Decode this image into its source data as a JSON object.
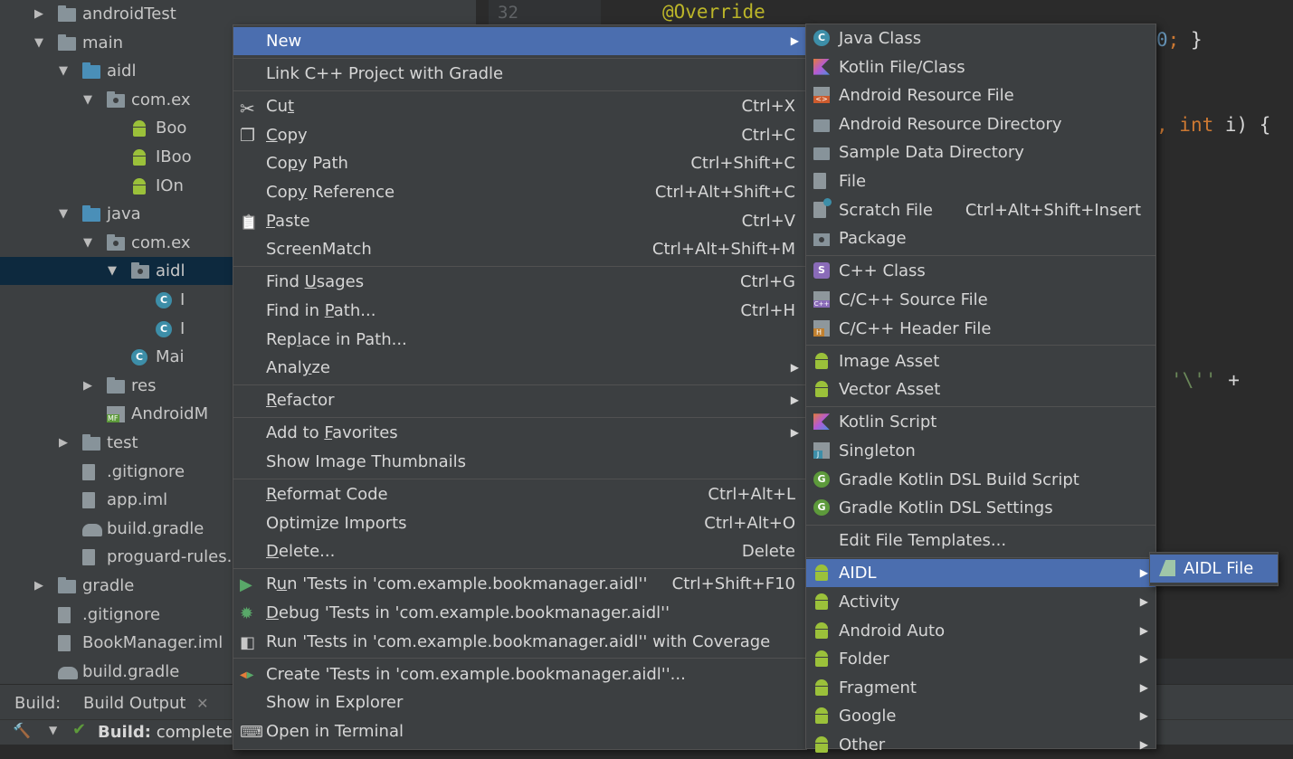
{
  "tree": [
    {
      "label": "androidTest",
      "indent": 1,
      "arrow": "▶",
      "icon": "folder"
    },
    {
      "label": "main",
      "indent": 1,
      "arrow": "▼",
      "icon": "folder"
    },
    {
      "label": "aidl",
      "indent": 2,
      "arrow": "▼",
      "icon": "folder-blue"
    },
    {
      "label": "com.ex",
      "indent": 3,
      "arrow": "▼",
      "icon": "package"
    },
    {
      "label": "Boo",
      "indent": 4,
      "arrow": "",
      "icon": "android"
    },
    {
      "label": "IBoo",
      "indent": 4,
      "arrow": "",
      "icon": "android"
    },
    {
      "label": "IOn",
      "indent": 4,
      "arrow": "",
      "icon": "android"
    },
    {
      "label": "java",
      "indent": 2,
      "arrow": "▼",
      "icon": "folder-blue"
    },
    {
      "label": "com.ex",
      "indent": 3,
      "arrow": "▼",
      "icon": "package"
    },
    {
      "label": "aidl",
      "indent": 4,
      "arrow": "▼",
      "icon": "package",
      "selected": true
    },
    {
      "label": "I",
      "indent": 5,
      "arrow": "",
      "icon": "class"
    },
    {
      "label": "I",
      "indent": 5,
      "arrow": "",
      "icon": "class"
    },
    {
      "label": "Mai",
      "indent": 4,
      "arrow": "",
      "icon": "class"
    },
    {
      "label": "res",
      "indent": 3,
      "arrow": "▶",
      "icon": "folder"
    },
    {
      "label": "AndroidM",
      "indent": 3,
      "arrow": "",
      "icon": "manifest"
    },
    {
      "label": "test",
      "indent": 2,
      "arrow": "▶",
      "icon": "folder"
    },
    {
      "label": ".gitignore",
      "indent": 2,
      "arrow": "",
      "icon": "file"
    },
    {
      "label": "app.iml",
      "indent": 2,
      "arrow": "",
      "icon": "file"
    },
    {
      "label": "build.gradle",
      "indent": 2,
      "arrow": "",
      "icon": "gradle"
    },
    {
      "label": "proguard-rules.p",
      "indent": 2,
      "arrow": "",
      "icon": "file"
    },
    {
      "label": "gradle",
      "indent": 1,
      "arrow": "▶",
      "icon": "folder"
    },
    {
      "label": ".gitignore",
      "indent": 1,
      "arrow": "",
      "icon": "file"
    },
    {
      "label": "BookManager.iml",
      "indent": 1,
      "arrow": "",
      "icon": "file"
    },
    {
      "label": "build.gradle",
      "indent": 1,
      "arrow": "",
      "icon": "gradle"
    }
  ],
  "editor": {
    "line_number": "32",
    "annotation": "@Override",
    "frag1": "0; }",
    "frag2_comma": ", ",
    "frag2_kw": "int",
    "frag2_rest": " i) {",
    "frag3_str": "'\\''",
    "frag3_op": " +"
  },
  "bottom": {
    "build_label": "Build:",
    "tab_label": "Build Output",
    "status": "Build: completed"
  },
  "context_menu": [
    {
      "label": "New",
      "shortcut": "",
      "submenu": true,
      "highlight": true,
      "icon": ""
    },
    {
      "sep": true
    },
    {
      "label": "Link C++ Project with Gradle",
      "shortcut": "",
      "icon": ""
    },
    {
      "sep": true
    },
    {
      "label": "Cut",
      "shortcut": "Ctrl+X",
      "icon": "scissors"
    },
    {
      "label": "Copy",
      "shortcut": "Ctrl+C",
      "icon": "copy"
    },
    {
      "label": "Copy Path",
      "shortcut": "Ctrl+Shift+C",
      "icon": ""
    },
    {
      "label": "Copy Reference",
      "shortcut": "Ctrl+Alt+Shift+C",
      "icon": ""
    },
    {
      "label": "Paste",
      "shortcut": "Ctrl+V",
      "icon": "clipboard"
    },
    {
      "label": "ScreenMatch",
      "shortcut": "Ctrl+Alt+Shift+M",
      "icon": ""
    },
    {
      "sep": true
    },
    {
      "label": "Find Usages",
      "shortcut": "Ctrl+G",
      "icon": ""
    },
    {
      "label": "Find in Path...",
      "shortcut": "Ctrl+H",
      "icon": ""
    },
    {
      "label": "Replace in Path...",
      "shortcut": "",
      "icon": ""
    },
    {
      "label": "Analyze",
      "shortcut": "",
      "submenu": true,
      "icon": ""
    },
    {
      "sep": true
    },
    {
      "label": "Refactor",
      "shortcut": "",
      "submenu": true,
      "icon": ""
    },
    {
      "sep": true
    },
    {
      "label": "Add to Favorites",
      "shortcut": "",
      "submenu": true,
      "icon": ""
    },
    {
      "label": "Show Image Thumbnails",
      "shortcut": "",
      "icon": ""
    },
    {
      "sep": true
    },
    {
      "label": "Reformat Code",
      "shortcut": "Ctrl+Alt+L",
      "icon": ""
    },
    {
      "label": "Optimize Imports",
      "shortcut": "Ctrl+Alt+O",
      "icon": ""
    },
    {
      "label": "Delete...",
      "shortcut": "Delete",
      "icon": ""
    },
    {
      "sep": true
    },
    {
      "label": "Run 'Tests in 'com.example.bookmanager.aidl''",
      "shortcut": "Ctrl+Shift+F10",
      "icon": "run"
    },
    {
      "label": "Debug 'Tests in 'com.example.bookmanager.aidl''",
      "shortcut": "",
      "icon": "debug"
    },
    {
      "label": "Run 'Tests in 'com.example.bookmanager.aidl'' with Coverage",
      "shortcut": "",
      "icon": "coverage"
    },
    {
      "sep": true
    },
    {
      "label": "Create 'Tests in 'com.example.bookmanager.aidl''...",
      "shortcut": "",
      "icon": "create"
    },
    {
      "label": "Show in Explorer",
      "shortcut": "",
      "icon": ""
    },
    {
      "label": "Open in Terminal",
      "shortcut": "",
      "icon": "terminal"
    }
  ],
  "new_menu": [
    {
      "label": "Java Class",
      "icon": "class"
    },
    {
      "label": "Kotlin File/Class",
      "icon": "kotlin"
    },
    {
      "label": "Android Resource File",
      "icon": "res"
    },
    {
      "label": "Android Resource Directory",
      "icon": "folder"
    },
    {
      "label": "Sample Data Directory",
      "icon": "folder"
    },
    {
      "label": "File",
      "icon": "file"
    },
    {
      "label": "Scratch File",
      "shortcut": "Ctrl+Alt+Shift+Insert",
      "icon": "scratch"
    },
    {
      "label": "Package",
      "icon": "package"
    },
    {
      "sep": true
    },
    {
      "label": "C++ Class",
      "icon": "cpp-class"
    },
    {
      "label": "C/C++ Source File",
      "icon": "cpp"
    },
    {
      "label": "C/C++ Header File",
      "icon": "header"
    },
    {
      "sep": true
    },
    {
      "label": "Image Asset",
      "icon": "android"
    },
    {
      "label": "Vector Asset",
      "icon": "android"
    },
    {
      "sep": true
    },
    {
      "label": "Kotlin Script",
      "icon": "kotlin"
    },
    {
      "label": "Singleton",
      "icon": "java-file"
    },
    {
      "label": "Gradle Kotlin DSL Build Script",
      "icon": "gradle-g"
    },
    {
      "label": "Gradle Kotlin DSL Settings",
      "icon": "gradle-g"
    },
    {
      "sep": true
    },
    {
      "label": "Edit File Templates...",
      "icon": ""
    },
    {
      "sep": true
    },
    {
      "label": "AIDL",
      "icon": "android",
      "submenu": true,
      "highlight": true
    },
    {
      "label": "Activity",
      "icon": "android",
      "submenu": true
    },
    {
      "label": "Android Auto",
      "icon": "android",
      "submenu": true
    },
    {
      "label": "Folder",
      "icon": "android",
      "submenu": true
    },
    {
      "label": "Fragment",
      "icon": "android",
      "submenu": true
    },
    {
      "label": "Google",
      "icon": "android",
      "submenu": true
    },
    {
      "label": "Other",
      "icon": "android",
      "submenu": true
    }
  ],
  "aidl_menu": [
    {
      "label": "AIDL File",
      "icon": "aidl",
      "highlight": true
    }
  ],
  "colors": {
    "highlight": "#4b6eaf",
    "menu_bg": "#3c3f41",
    "editor_bg": "#2b2b2b",
    "annotation": "#bbb529",
    "keyword": "#cc7832",
    "string": "#6a8759"
  }
}
